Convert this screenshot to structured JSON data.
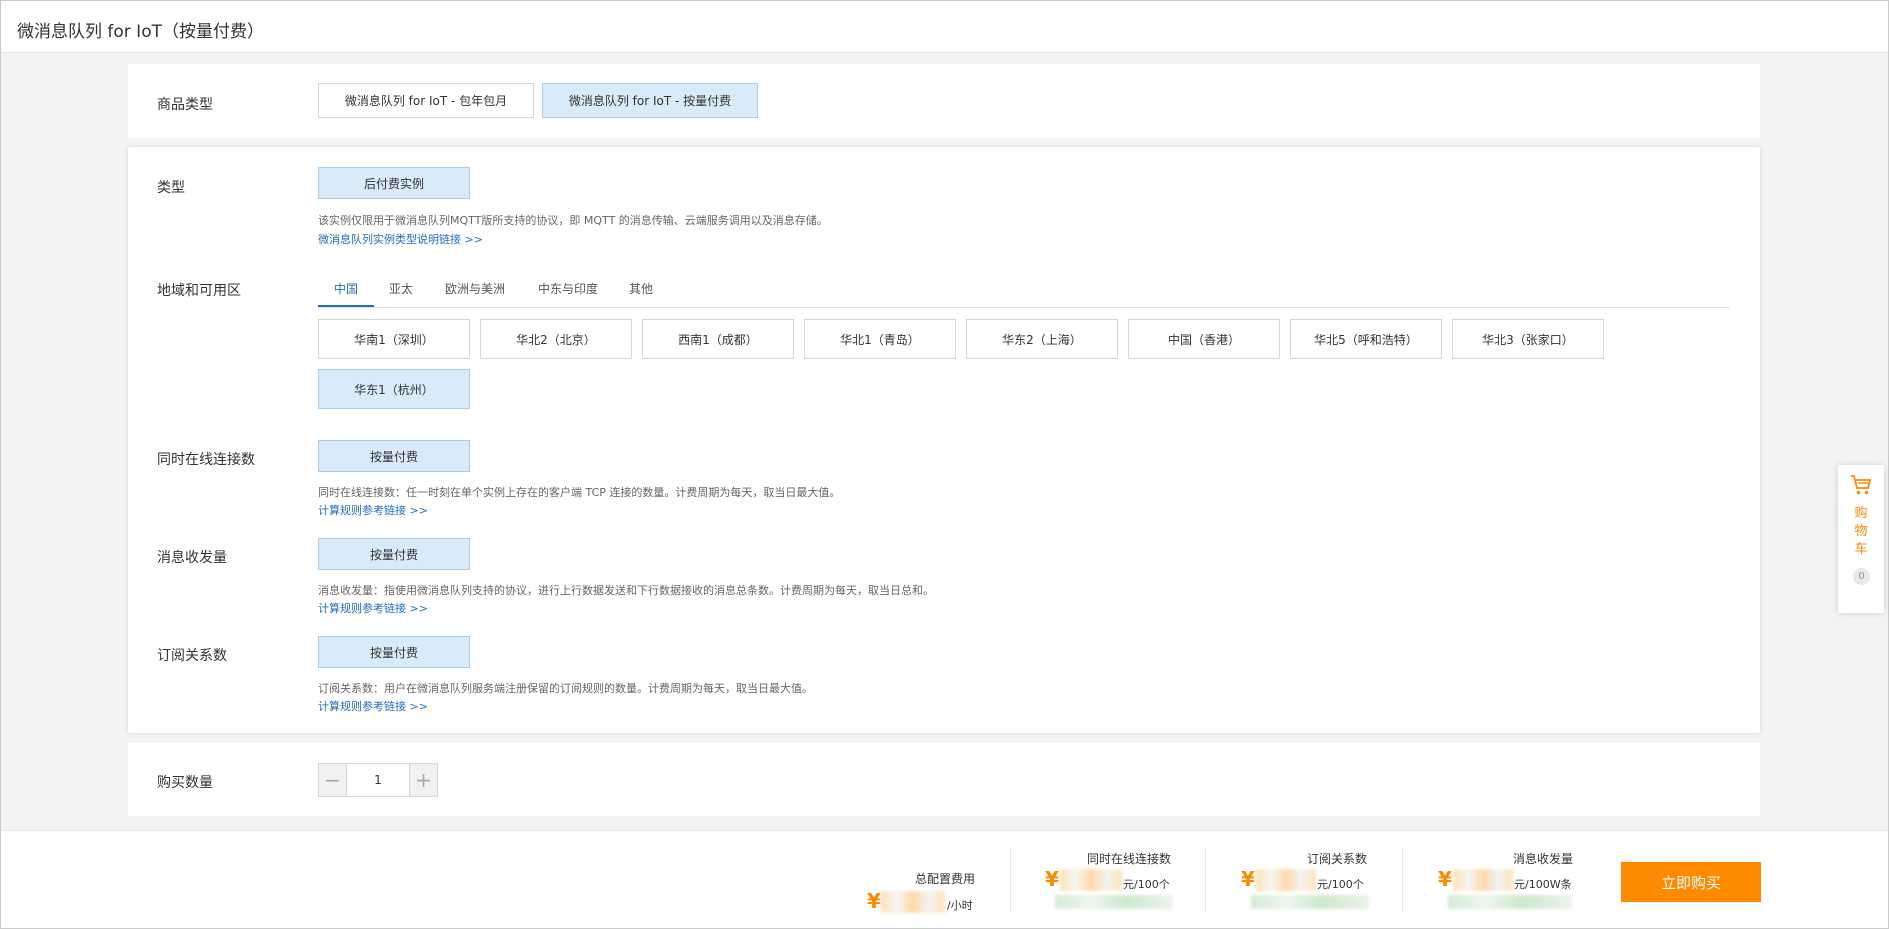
{
  "page": {
    "title": "微消息队列 for IoT（按量付费）"
  },
  "product_type": {
    "label": "商品类型",
    "options": [
      "微消息队列 for IoT - 包年包月",
      "微消息队列 for IoT - 按量付费"
    ],
    "selected": 1
  },
  "instance_type": {
    "label": "类型",
    "option": "后付费实例",
    "desc": "该实例仅限用于微消息队列MQTT版所支持的协议，即 MQTT 的消息传输、云端服务调用以及消息存储。",
    "link": "微消息队列实例类型说明链接 >>"
  },
  "region": {
    "label": "地域和可用区",
    "tabs": [
      "中国",
      "亚太",
      "欧洲与美洲",
      "中东与印度",
      "其他"
    ],
    "active_tab": 0,
    "options": [
      "华南1（深圳）",
      "华北2（北京）",
      "西南1（成都）",
      "华北1（青岛）",
      "华东2（上海）",
      "中国（香港）",
      "华北5（呼和浩特）",
      "华北3（张家口）",
      "华东1（杭州）"
    ],
    "selected": 8
  },
  "connections": {
    "label": "同时在线连接数",
    "option": "按量付费",
    "desc": "同时在线连接数：任一时刻在单个实例上存在的客户端 TCP 连接的数量。计费周期为每天，取当日最大值。",
    "link": "计算规则参考链接 >>"
  },
  "messages": {
    "label": "消息收发量",
    "option": "按量付费",
    "desc": "消息收发量：指使用微消息队列支持的协议，进行上行数据发送和下行数据接收的消息总条数。计费周期为每天，取当日总和。",
    "link": "计算规则参考链接 >>"
  },
  "subscriptions": {
    "label": "订阅关系数",
    "option": "按量付费",
    "desc": "订阅关系数：用户在微消息队列服务端注册保留的订阅规则的数量。计费周期为每天，取当日最大值。",
    "link": "计算规则参考链接 >>"
  },
  "quantity": {
    "label": "购买数量",
    "value": "1",
    "minus": "−",
    "plus": "+"
  },
  "bottom": {
    "total": {
      "title": "总配置费用",
      "currency": "¥",
      "unit": "/小时"
    },
    "fees": [
      {
        "title": "同时在线连接数",
        "currency": "¥",
        "unit": "元/100个"
      },
      {
        "title": "订阅关系数",
        "currency": "¥",
        "unit": "元/100个"
      },
      {
        "title": "消息收发量",
        "currency": "¥",
        "unit": "元/100W条"
      }
    ],
    "buy_label": "立即购买"
  },
  "cart": {
    "label": "购物车",
    "count": "0"
  },
  "colors": {
    "accent": "#ff8a00",
    "link": "#1f6fc5",
    "selected_bg": "#d9eaf8"
  }
}
